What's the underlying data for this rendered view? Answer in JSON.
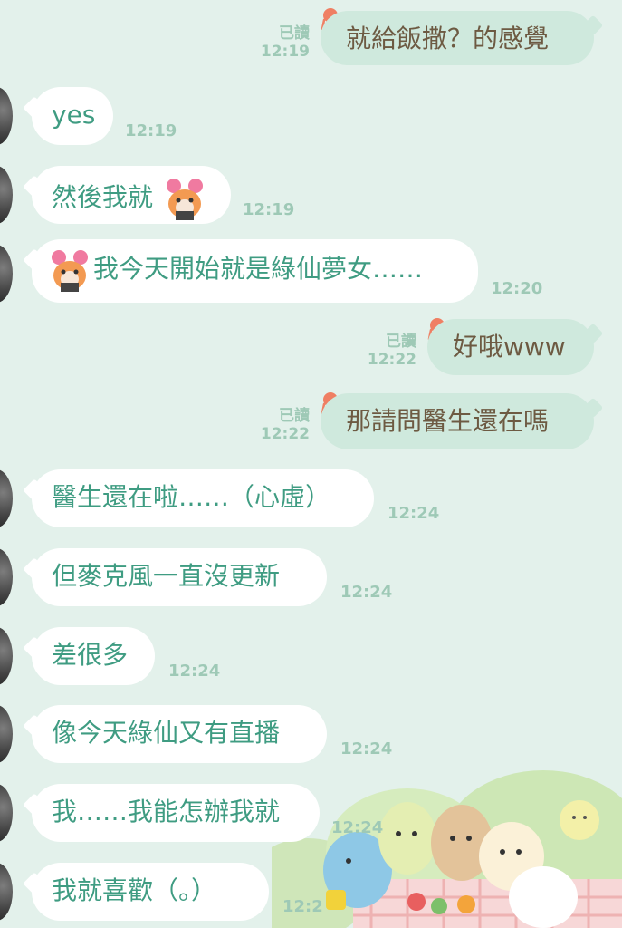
{
  "chat": {
    "messages": [
      {
        "side": "out",
        "read": "已讀",
        "time": "12:19",
        "text": "就給飯撒？的感覺"
      },
      {
        "side": "in",
        "time": "12:19",
        "text": "yes"
      },
      {
        "side": "in",
        "time": "12:19",
        "text": "然後我就"
      },
      {
        "side": "in",
        "time": "12:20",
        "text": "我今天開始就是綠仙夢女……"
      },
      {
        "side": "out",
        "read": "已讀",
        "time": "12:22",
        "text": "好哦www"
      },
      {
        "side": "out",
        "read": "已讀",
        "time": "12:22",
        "text": "那請問醫生還在嗎"
      },
      {
        "side": "in",
        "time": "12:24",
        "text": "醫生還在啦……（心虛）"
      },
      {
        "side": "in",
        "time": "12:24",
        "text": "但麥克風一直沒更新"
      },
      {
        "side": "in",
        "time": "12:24",
        "text": "差很多"
      },
      {
        "side": "in",
        "time": "12:24",
        "text": "像今天綠仙又有直播"
      },
      {
        "side": "in",
        "time": "12:24",
        "text": "我……我能怎辦我就"
      },
      {
        "side": "in",
        "time": "12:2",
        "text": "我就喜歡（。）"
      }
    ]
  },
  "colors": {
    "background": "#e3f1eb",
    "incoming_bubble": "#ffffff",
    "incoming_text": "#3f9c82",
    "outgoing_bubble": "#cfe9dd",
    "outgoing_text": "#6d5a42",
    "meta_text": "#9ec9b6"
  },
  "icons": {
    "read_marker": "octopus-icon",
    "inline_sticker": "blushing-character-sticker",
    "wallpaper": "picnic-characters-illustration"
  }
}
